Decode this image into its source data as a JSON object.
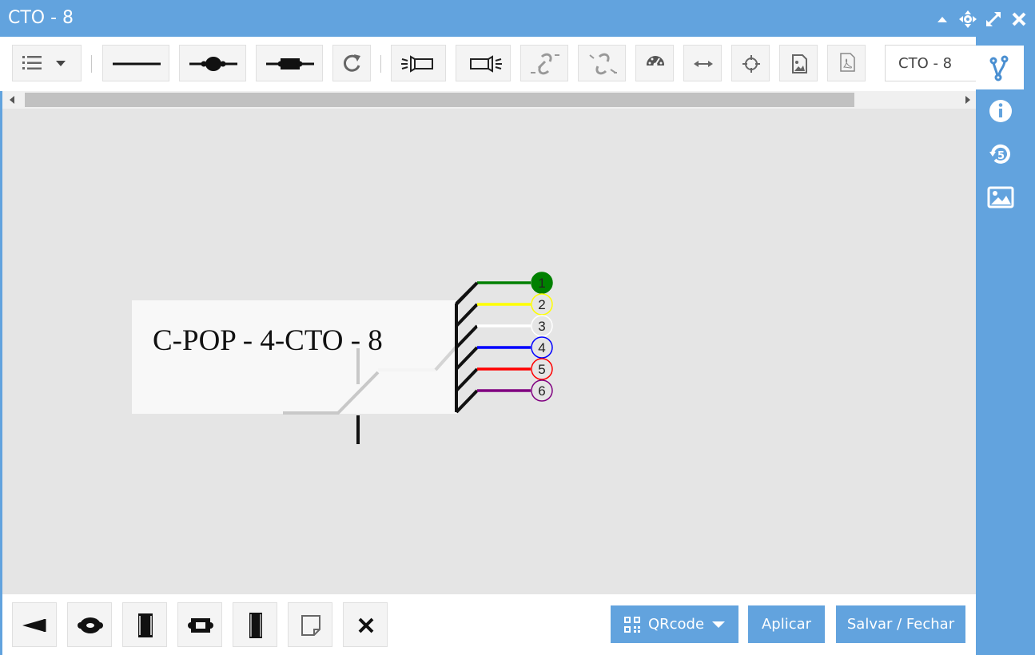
{
  "window": {
    "title": "CTO - 8"
  },
  "toolbar": {
    "buttons": [
      {
        "name": "list-menu"
      },
      {
        "name": "cable-line"
      },
      {
        "name": "splice-round"
      },
      {
        "name": "splice-box"
      },
      {
        "name": "refresh"
      },
      {
        "name": "light-source"
      },
      {
        "name": "light-meter"
      },
      {
        "name": "connect"
      },
      {
        "name": "disconnect"
      },
      {
        "name": "gauge"
      },
      {
        "name": "measure"
      },
      {
        "name": "locate"
      },
      {
        "name": "image-export"
      },
      {
        "name": "pdf-export"
      }
    ],
    "name_field_value": "CTO - 8"
  },
  "diagram": {
    "box_label": "C-POP - 4-CTO - 8",
    "fibers": [
      {
        "num": "1",
        "color": "#008000",
        "filled": true
      },
      {
        "num": "2",
        "color": "#ffff00",
        "filled": false
      },
      {
        "num": "3",
        "color": "#ffffff",
        "filled": false
      },
      {
        "num": "4",
        "color": "#0000ff",
        "filled": false
      },
      {
        "num": "5",
        "color": "#ff0000",
        "filled": false
      },
      {
        "num": "6",
        "color": "#800080",
        "filled": false
      }
    ]
  },
  "bottom": {
    "qrcode_label": "QRcode",
    "apply_label": "Aplicar",
    "save_close_label": "Salvar / Fechar"
  },
  "colors": {
    "accent": "#62a3de",
    "canvas": "#e5e5e5"
  }
}
